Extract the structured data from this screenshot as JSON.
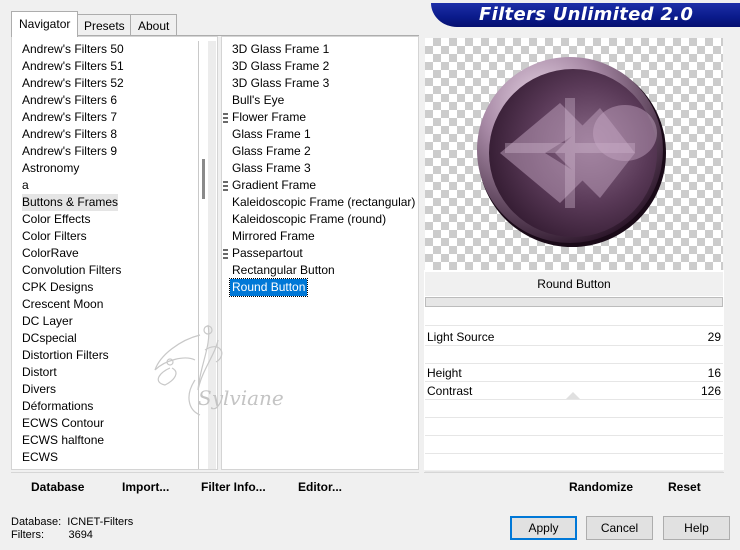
{
  "title": "Filters Unlimited 2.0",
  "tabs": [
    {
      "label": "Navigator"
    },
    {
      "label": "Presets"
    },
    {
      "label": "About"
    }
  ],
  "categories": [
    "Andrew's Filters 50",
    "Andrew's Filters 51",
    "Andrew's Filters 52",
    "Andrew's Filters 6",
    "Andrew's Filters 7",
    "Andrew's Filters 8",
    "Andrew's Filters 9",
    "Astronomy",
    "a",
    "Buttons & Frames",
    "Color Effects",
    "Color Filters",
    "ColorRave",
    "Convolution Filters",
    "CPK Designs",
    "Crescent Moon",
    "DC Layer",
    "DCspecial",
    "Distortion Filters",
    "Distort",
    "Divers",
    "Déformations",
    "ECWS Contour",
    "ECWS halftone",
    "ECWS"
  ],
  "filters": [
    {
      "label": "3D Glass Frame 1",
      "marker": false
    },
    {
      "label": "3D Glass Frame 2",
      "marker": false
    },
    {
      "label": "3D Glass Frame 3",
      "marker": false
    },
    {
      "label": "Bull's Eye",
      "marker": false
    },
    {
      "label": "Flower Frame",
      "marker": true
    },
    {
      "label": "Glass Frame 1",
      "marker": false
    },
    {
      "label": "Glass Frame 2",
      "marker": false
    },
    {
      "label": "Glass Frame 3",
      "marker": false
    },
    {
      "label": "Gradient Frame",
      "marker": true
    },
    {
      "label": "Kaleidoscopic Frame (rectangular)",
      "marker": false
    },
    {
      "label": "Kaleidoscopic Frame (round)",
      "marker": false
    },
    {
      "label": "Mirrored Frame",
      "marker": false
    },
    {
      "label": "Passepartout",
      "marker": true
    },
    {
      "label": "Rectangular Button",
      "marker": false
    },
    {
      "label": "Round Button",
      "marker": false
    }
  ],
  "selected_category": "Buttons & Frames",
  "selected_filter": "Round Button",
  "preview_filter_name": "Round Button",
  "params": [
    {
      "label": "Light Source",
      "value": "29"
    },
    {
      "label": "Height",
      "value": "16"
    },
    {
      "label": "Contrast",
      "value": "126"
    }
  ],
  "toolbar": {
    "database": "Database",
    "import": "Import...",
    "filter_info": "Filter Info...",
    "editor": "Editor...",
    "randomize": "Randomize",
    "reset": "Reset"
  },
  "status": {
    "database_label": "Database:",
    "database_value": "ICNET-Filters",
    "filters_label": "Filters:",
    "filters_value": "3694"
  },
  "buttons": {
    "apply": "Apply",
    "cancel": "Cancel",
    "help": "Help"
  },
  "watermark": "Sylviane",
  "colors": {
    "banner": "#0a1a8a",
    "selection": "#0078d7",
    "button_purple": "#4a2a48"
  }
}
